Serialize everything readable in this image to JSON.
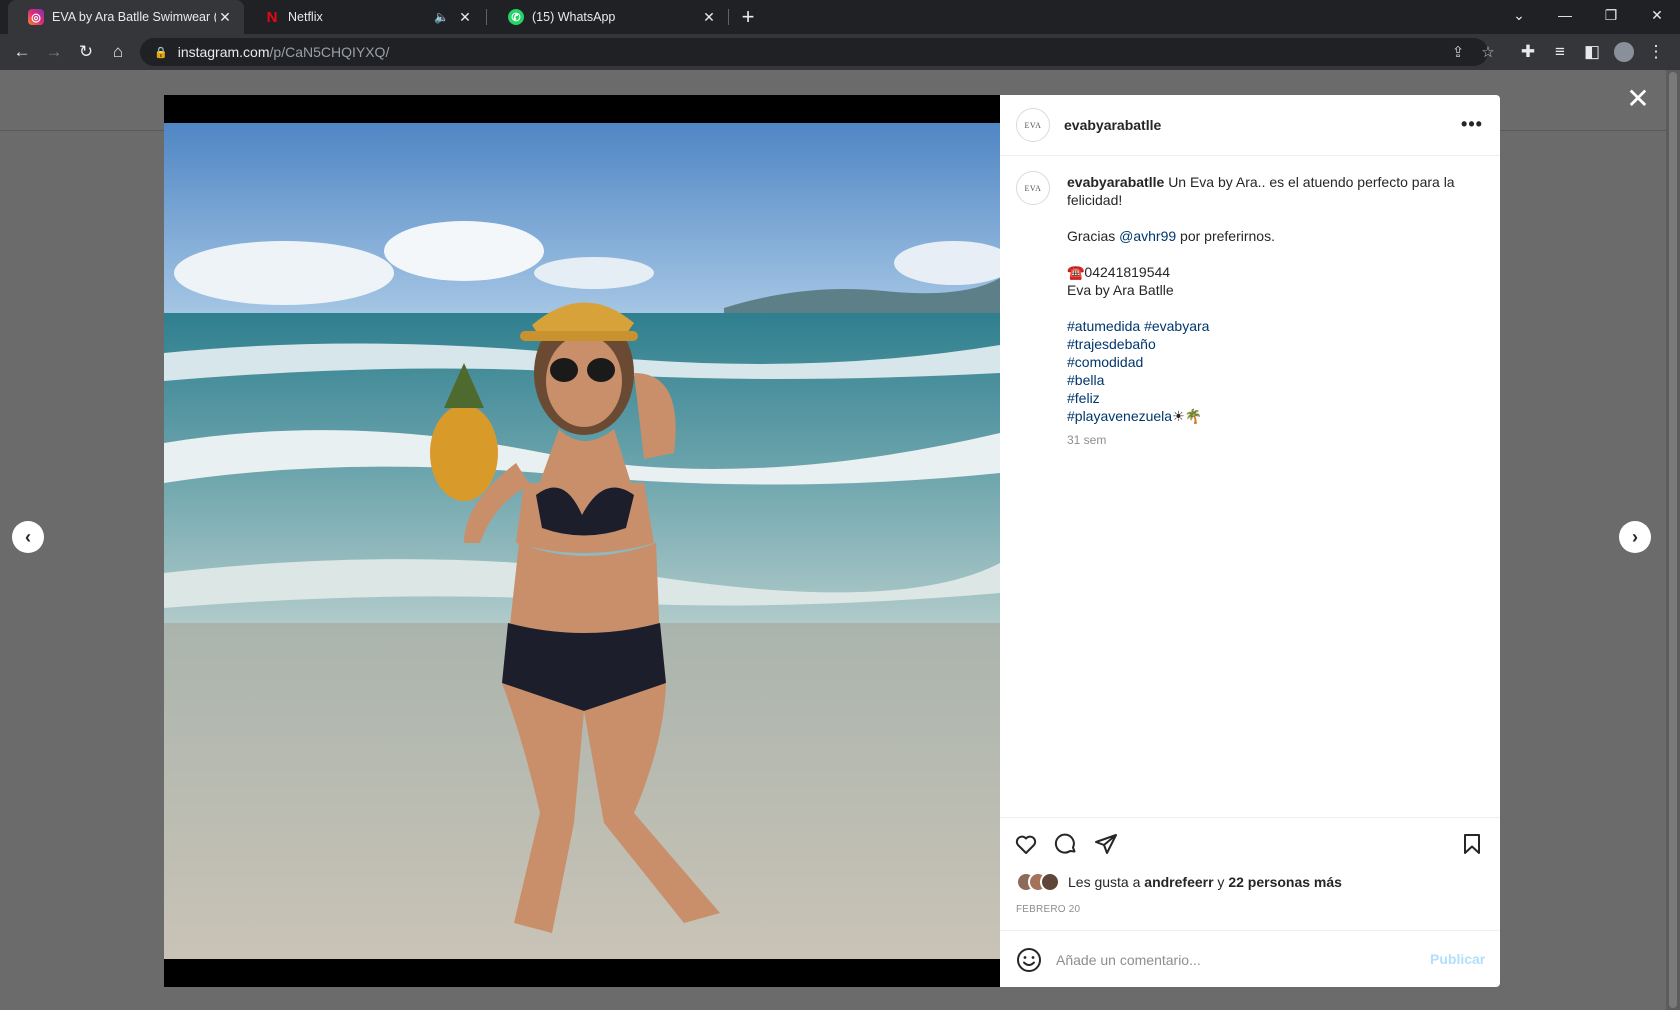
{
  "browser": {
    "tabs": [
      {
        "title": "EVA by Ara Batlle Swimwear (@",
        "favicon": "instagram-icon"
      },
      {
        "title": "Netflix",
        "favicon": "netflix-icon",
        "audio": "mute-icon"
      },
      {
        "title": "(15) WhatsApp",
        "favicon": "whatsapp-icon"
      }
    ],
    "url_host": "instagram.com",
    "url_path": "/p/CaN5CHQIYXQ/"
  },
  "post": {
    "username": "evabyarabatlle",
    "avatar_text": "EVA",
    "caption": {
      "lead": "Un Eva by Ara.. es el atuendo perfecto para la felicidad!",
      "thanks_pre": "Gracias ",
      "mention": "@avhr99",
      "thanks_post": " por preferirnos.",
      "phone": "☎️04241819544",
      "brand": "Eva by Ara Batlle",
      "tags_line1_a": "#atumedida",
      "tags_line1_b": "#evabyara",
      "tags": [
        "#trajesdebaño",
        "#comodidad",
        "#bella",
        "#feliz"
      ],
      "last_tag": "#playavenezuela",
      "last_tag_emoji": "☀🌴",
      "time": "31 sem"
    },
    "likes": {
      "prefix": "Les gusta a ",
      "user": "andrefeerr",
      "middle": " y ",
      "others": "22 personas más"
    },
    "date": "FEBRERO 20",
    "comment_placeholder": "Añade un comentario...",
    "publish_label": "Publicar"
  },
  "colors": {
    "link": "#00376b",
    "publish_disabled": "#b2dffc",
    "overlay": "#6b6b6b"
  }
}
